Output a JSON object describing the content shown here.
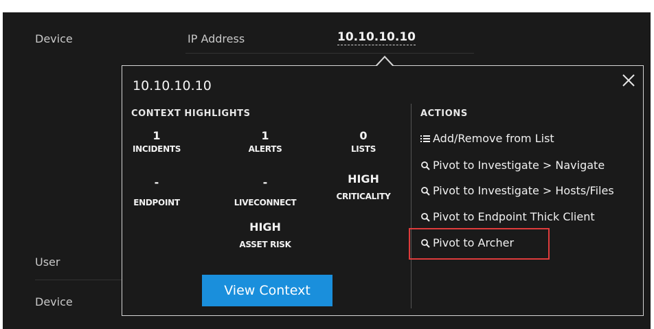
{
  "background": {
    "labels": [
      "Device",
      "IP Address",
      "User",
      "Device"
    ],
    "ip_value": "10.10.10.10"
  },
  "popover": {
    "title": "10.10.10.10",
    "close_icon": "close-icon",
    "context_highlights": {
      "heading": "CONTEXT HIGHLIGHTS",
      "stats": [
        {
          "value": "1",
          "label": "INCIDENTS"
        },
        {
          "value": "1",
          "label": "ALERTS"
        },
        {
          "value": "0",
          "label": "LISTS"
        },
        {
          "value": "-",
          "label": "ENDPOINT"
        },
        {
          "value": "-",
          "label": "LIVECONNECT"
        },
        {
          "value": "HIGH",
          "label": "CRITICALITY"
        },
        {
          "value": "HIGH",
          "label": "ASSET RISK"
        }
      ],
      "button_label": "View Context"
    },
    "actions": {
      "heading": "ACTIONS",
      "items": [
        {
          "label": "Add/Remove from List",
          "icon": "list-icon"
        },
        {
          "label": "Pivot to Investigate > Navigate",
          "icon": "search-icon"
        },
        {
          "label": "Pivot to Investigate > Hosts/Files",
          "icon": "search-icon"
        },
        {
          "label": "Pivot to Endpoint Thick Client",
          "icon": "search-icon"
        },
        {
          "label": "Pivot to Archer",
          "icon": "search-icon"
        }
      ]
    }
  },
  "colors": {
    "background": "#1a1a1a",
    "button": "#1a8fdc",
    "highlight_box": "#e03c3c"
  }
}
